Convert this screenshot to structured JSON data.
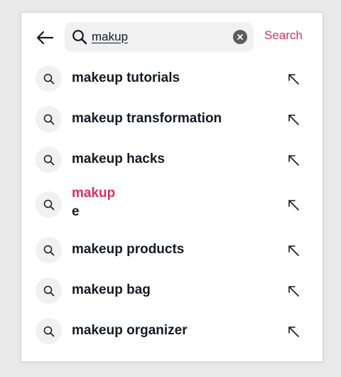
{
  "search": {
    "query": "makup",
    "button_label": "Search"
  },
  "suggestions": [
    {
      "text": "makeup tutorials"
    },
    {
      "text": "makeup transformation"
    },
    {
      "text": "makeup hacks"
    },
    {
      "highlight": "makup",
      "rest": "e"
    },
    {
      "text": "makeup products"
    },
    {
      "text": "makeup bag"
    },
    {
      "text": "makeup organizer"
    }
  ],
  "icons": {
    "back": "arrow-left-icon",
    "search": "search-icon",
    "clear": "clear-x-icon",
    "fill": "arrow-up-left-icon"
  },
  "colors": {
    "accent": "#d4335f",
    "text": "#161823",
    "chip_bg": "#f1f1f2"
  }
}
